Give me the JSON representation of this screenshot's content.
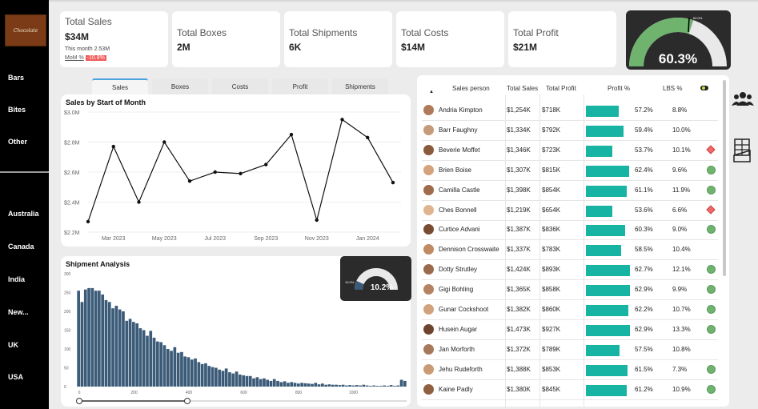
{
  "sidebar": {
    "logo_text": "Chocolate",
    "categories": [
      "Bars",
      "Bites",
      "Other"
    ],
    "countries": [
      "Australia",
      "Canada",
      "India",
      "New...",
      "UK",
      "USA"
    ]
  },
  "kpis": {
    "total_sales": {
      "label": "Total Sales",
      "value": "$34M",
      "this_month": "This month 2.53M",
      "mom_label": "MoM %",
      "mom_value": "-10.8%"
    },
    "total_boxes": {
      "label": "Total Boxes",
      "value": "2M"
    },
    "total_shipments": {
      "label": "Total Shipments",
      "value": "6K"
    },
    "total_costs": {
      "label": "Total Costs",
      "value": "$14M"
    },
    "total_profit": {
      "label": "Total Profit",
      "value": "$21M"
    }
  },
  "profit_gauge": {
    "value_text": "60.3%",
    "value": 60.3,
    "target_text": "60.0%",
    "color": "#6fb36f"
  },
  "tabs": [
    "Sales",
    "Boxes",
    "Costs",
    "Profit",
    "Shipments"
  ],
  "active_tab": "Sales",
  "sales_chart": {
    "title": "Sales by Start of Month",
    "chart_data": {
      "type": "line",
      "x": [
        "2023-01",
        "2023-02",
        "2023-03",
        "2023-04",
        "2023-05",
        "2023-06",
        "2023-07",
        "2023-08",
        "2023-09",
        "2023-10",
        "2023-11",
        "2023-12",
        "2024-01",
        "2024-02"
      ],
      "x_tick_labels": [
        "Mar 2023",
        "May 2023",
        "Jul 2023",
        "Sep 2023",
        "Nov 2023",
        "Jan 2024"
      ],
      "y_tick_labels": [
        "$3.0M",
        "$2.8M",
        "$2.6M",
        "$2.4M",
        "$2.2M"
      ],
      "values": [
        2.27,
        2.77,
        2.4,
        2.8,
        2.54,
        2.6,
        2.59,
        2.65,
        2.85,
        2.28,
        2.95,
        2.83,
        2.53
      ],
      "ylim": [
        2.2,
        3.0
      ],
      "grid": true
    }
  },
  "shipment_chart": {
    "title": "Shipment Analysis",
    "gauge_value_text": "10.2%",
    "gauge_target_text": "10.0%",
    "chart_data": {
      "type": "bar",
      "color": "#3b5b78",
      "y_tick_labels": [
        "300",
        "250",
        "200",
        "150",
        "100",
        "50",
        "0"
      ],
      "x_tick_labels": [
        "0",
        "200",
        "400",
        "600",
        "800",
        "1000"
      ],
      "ylim": [
        0,
        300
      ],
      "values": [
        255,
        225,
        258,
        262,
        262,
        255,
        255,
        245,
        230,
        225,
        208,
        215,
        205,
        200,
        175,
        180,
        172,
        168,
        155,
        150,
        135,
        148,
        130,
        120,
        118,
        110,
        100,
        95,
        105,
        90,
        92,
        80,
        78,
        72,
        75,
        65,
        60,
        62,
        55,
        52,
        50,
        45,
        42,
        48,
        38,
        35,
        40,
        32,
        30,
        28,
        28,
        22,
        25,
        20,
        22,
        18,
        15,
        20,
        15,
        12,
        14,
        10,
        12,
        10,
        8,
        10,
        9,
        8,
        7,
        10,
        6,
        8,
        5,
        6,
        5,
        5,
        4,
        5,
        3,
        4,
        3,
        4,
        3,
        5,
        3,
        2,
        3,
        2,
        2,
        3,
        2,
        4,
        2,
        3,
        18,
        15
      ]
    }
  },
  "table": {
    "headers": [
      "Sales person",
      "Total Sales",
      "Total Profit",
      "Profit %",
      "LBS %"
    ],
    "rows": [
      {
        "name": "Andria Kimpton",
        "sales": "$1,254K",
        "profit": "$718K",
        "profit_pct": "57.2%",
        "lbs": "8.8%",
        "pct": 57.2,
        "status": "none"
      },
      {
        "name": "Barr Faughny",
        "sales": "$1,334K",
        "profit": "$792K",
        "profit_pct": "59.4%",
        "lbs": "10.0%",
        "pct": 59.4,
        "status": "none"
      },
      {
        "name": "Beverie Moffet",
        "sales": "$1,346K",
        "profit": "$723K",
        "profit_pct": "53.7%",
        "lbs": "10.1%",
        "pct": 53.7,
        "status": "red"
      },
      {
        "name": "Brien Boise",
        "sales": "$1,307K",
        "profit": "$815K",
        "profit_pct": "62.4%",
        "lbs": "9.6%",
        "pct": 62.4,
        "status": "green"
      },
      {
        "name": "Camilla Castle",
        "sales": "$1,398K",
        "profit": "$854K",
        "profit_pct": "61.1%",
        "lbs": "11.9%",
        "pct": 61.1,
        "status": "green"
      },
      {
        "name": "Ches Bonnell",
        "sales": "$1,219K",
        "profit": "$654K",
        "profit_pct": "53.6%",
        "lbs": "6.6%",
        "pct": 53.6,
        "status": "red"
      },
      {
        "name": "Curtice Advani",
        "sales": "$1,387K",
        "profit": "$836K",
        "profit_pct": "60.3%",
        "lbs": "9.0%",
        "pct": 60.3,
        "status": "green"
      },
      {
        "name": "Dennison Crosswaite",
        "sales": "$1,337K",
        "profit": "$783K",
        "profit_pct": "58.5%",
        "lbs": "10.4%",
        "pct": 58.5,
        "status": "none"
      },
      {
        "name": "Dotty Strutley",
        "sales": "$1,424K",
        "profit": "$893K",
        "profit_pct": "62.7%",
        "lbs": "12.1%",
        "pct": 62.7,
        "status": "green"
      },
      {
        "name": "Gigi Bohling",
        "sales": "$1,365K",
        "profit": "$858K",
        "profit_pct": "62.9%",
        "lbs": "9.9%",
        "pct": 62.9,
        "status": "green"
      },
      {
        "name": "Gunar Cockshoot",
        "sales": "$1,382K",
        "profit": "$860K",
        "profit_pct": "62.2%",
        "lbs": "10.7%",
        "pct": 62.2,
        "status": "green"
      },
      {
        "name": "Husein Augar",
        "sales": "$1,473K",
        "profit": "$927K",
        "profit_pct": "62.9%",
        "lbs": "13.3%",
        "pct": 62.9,
        "status": "green"
      },
      {
        "name": "Jan Morforth",
        "sales": "$1,372K",
        "profit": "$789K",
        "profit_pct": "57.5%",
        "lbs": "10.8%",
        "pct": 57.5,
        "status": "none"
      },
      {
        "name": "Jehu Rudeforth",
        "sales": "$1,388K",
        "profit": "$853K",
        "profit_pct": "61.5%",
        "lbs": "7.3%",
        "pct": 61.5,
        "status": "green"
      },
      {
        "name": "Kaine Padly",
        "sales": "$1,380K",
        "profit": "$845K",
        "profit_pct": "61.2%",
        "lbs": "10.9%",
        "pct": 61.2,
        "status": "green"
      }
    ]
  },
  "colors": {
    "accent": "#17b3a3",
    "good": "#6fb36f",
    "bad": "#ef6a6a",
    "bar": "#3b5b78"
  },
  "icons": {
    "right_panel": [
      "people-icon",
      "chocolate-bar-icon"
    ]
  }
}
